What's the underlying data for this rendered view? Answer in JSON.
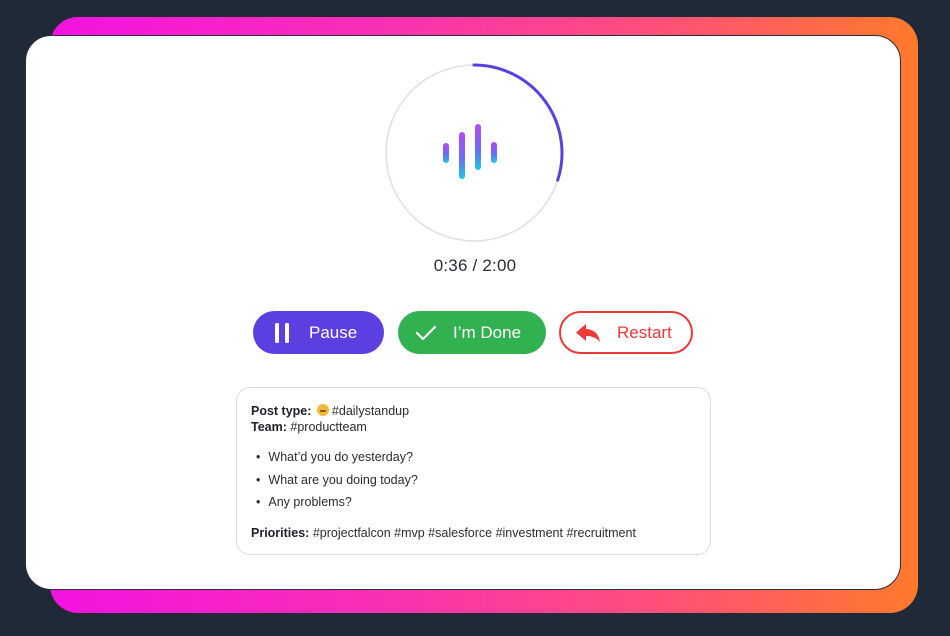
{
  "timer": {
    "elapsed_label": "0:36 / 2:00",
    "progress": 0.3,
    "accent_color": "#5b3fe0"
  },
  "controls": {
    "pause_label": "Pause",
    "pause_icon": "pause-icon",
    "done_label": "I’m Done",
    "done_icon": "check-icon",
    "restart_label": "Restart",
    "restart_icon": "reply-arrow-icon",
    "colors": {
      "pause": "#5b3fe0",
      "done": "#31b150",
      "restart": "#ea3a3a"
    }
  },
  "post": {
    "type_label": "Post type:",
    "type_emoji": "grinning-face-icon",
    "type_value": "#dailystandup",
    "team_label": "Team:",
    "team_value": "#productteam",
    "questions": [
      "What’d you do yesterday?",
      "What are you doing today?",
      "Any problems?"
    ],
    "priorities_label": "Priorities:",
    "priorities_value": "#projectfalcon #mvp #salesforce #investment #recruitment"
  }
}
